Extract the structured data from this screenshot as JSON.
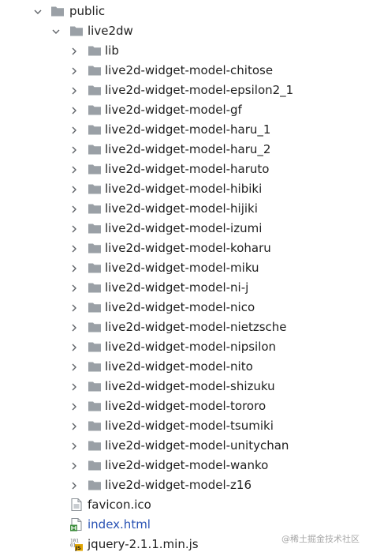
{
  "tree": {
    "root": {
      "label": "public",
      "expanded": true
    },
    "child": {
      "label": "live2dw",
      "expanded": true
    },
    "folders": [
      "lib",
      "live2d-widget-model-chitose",
      "live2d-widget-model-epsilon2_1",
      "live2d-widget-model-gf",
      "live2d-widget-model-haru_1",
      "live2d-widget-model-haru_2",
      "live2d-widget-model-haruto",
      "live2d-widget-model-hibiki",
      "live2d-widget-model-hijiki",
      "live2d-widget-model-izumi",
      "live2d-widget-model-koharu",
      "live2d-widget-model-miku",
      "live2d-widget-model-ni-j",
      "live2d-widget-model-nico",
      "live2d-widget-model-nietzsche",
      "live2d-widget-model-nipsilon",
      "live2d-widget-model-nito",
      "live2d-widget-model-shizuku",
      "live2d-widget-model-tororo",
      "live2d-widget-model-tsumiki",
      "live2d-widget-model-unitychan",
      "live2d-widget-model-wanko",
      "live2d-widget-model-z16"
    ],
    "files": [
      {
        "label": "favicon.ico",
        "icon": "ico-file-icon",
        "modified": false
      },
      {
        "label": "index.html",
        "icon": "html-file-icon",
        "modified": true
      },
      {
        "label": "jquery-2.1.1.min.js",
        "icon": "js-binary-file-icon",
        "modified": false
      }
    ]
  },
  "colors": {
    "folder": "#9aa0a6",
    "chevron": "#5f6368",
    "modified_text": "#2a53b4",
    "html_badge": "#3c8d3c",
    "js_badge": "#e0a400"
  },
  "watermark": "@稀土掘金技术社区"
}
